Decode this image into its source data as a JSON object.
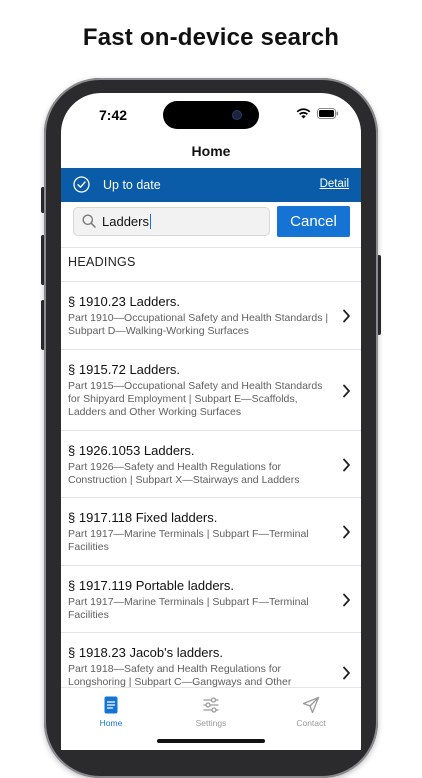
{
  "headline": "Fast on-device search",
  "status": {
    "time": "7:42"
  },
  "nav": {
    "title": "Home"
  },
  "banner": {
    "text": "Up to date",
    "link": "Detail"
  },
  "search": {
    "value": "Ladders",
    "cancel_label": "Cancel"
  },
  "section_header": "HEADINGS",
  "results": [
    {
      "title": "§ 1910.23 Ladders.",
      "subtitle": "Part 1910—Occupational Safety and Health Standards | Subpart D—Walking-Working Surfaces"
    },
    {
      "title": "§ 1915.72 Ladders.",
      "subtitle": "Part 1915—Occupational Safety and Health Standards for Shipyard Employment | Subpart E—Scaffolds, Ladders and Other Working Surfaces"
    },
    {
      "title": "§ 1926.1053 Ladders.",
      "subtitle": "Part 1926—Safety and Health Regulations for Construction | Subpart X—Stairways and Ladders"
    },
    {
      "title": "§ 1917.118 Fixed ladders.",
      "subtitle": "Part 1917—Marine Terminals | Subpart F—Terminal Facilities"
    },
    {
      "title": "§ 1917.119 Portable ladders.",
      "subtitle": "Part 1917—Marine Terminals | Subpart F—Terminal Facilities"
    },
    {
      "title": "§ 1918.23 Jacob's ladders.",
      "subtitle": "Part 1918—Safety and Health Regulations for Longshoring | Subpart C—Gangways and Other"
    }
  ],
  "tabs": [
    {
      "label": "Home",
      "icon": "document-icon",
      "active": true
    },
    {
      "label": "Settings",
      "icon": "sliders-icon",
      "active": false
    },
    {
      "label": "Contact",
      "icon": "paper-plane-icon",
      "active": false
    }
  ],
  "colors": {
    "accent": "#1473d3",
    "banner": "#0a5ca8",
    "inactive": "#9a9a9a"
  }
}
